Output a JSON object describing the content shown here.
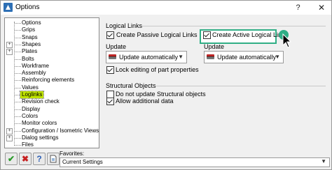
{
  "window": {
    "title": "Options",
    "help_glyph": "?",
    "close_glyph": "✕"
  },
  "tree": {
    "items": [
      {
        "label": "Options",
        "expander": ""
      },
      {
        "label": "Grips",
        "expander": ""
      },
      {
        "label": "Snaps",
        "expander": ""
      },
      {
        "label": "Shapes",
        "expander": "+"
      },
      {
        "label": "Plates",
        "expander": "+"
      },
      {
        "label": "Bolts",
        "expander": ""
      },
      {
        "label": "Workframe",
        "expander": ""
      },
      {
        "label": "Assembly",
        "expander": ""
      },
      {
        "label": "Reinforcing elements",
        "expander": ""
      },
      {
        "label": "Values",
        "expander": ""
      },
      {
        "label": "Loglinks",
        "expander": "",
        "selected": true
      },
      {
        "label": "Revision check",
        "expander": ""
      },
      {
        "label": "Display",
        "expander": ""
      },
      {
        "label": "Colors",
        "expander": ""
      },
      {
        "label": "Monitor colors",
        "expander": ""
      },
      {
        "label": "Configuration / Isometric Views",
        "expander": "+"
      },
      {
        "label": "Dialog settings",
        "expander": "+"
      },
      {
        "label": "Files",
        "expander": ""
      }
    ]
  },
  "logical_links": {
    "heading": "Logical Links",
    "passive": {
      "label": "Create Passive Logical Links",
      "checked": true
    },
    "active": {
      "label": "Create Active Logical Links",
      "checked": true
    },
    "update_left_label": "Update",
    "update_left_value": "Update automatically",
    "update_right_label": "Update",
    "update_right_value": "Update automatically",
    "lock": {
      "label": "Lock editing of part properties",
      "checked": true
    }
  },
  "structural": {
    "heading": "Structural Objects",
    "no_update": {
      "label": "Do not update Structural objects",
      "checked": false
    },
    "allow_data": {
      "label": "Allow additional data",
      "checked": true
    }
  },
  "bottom": {
    "ok_glyph": "✔",
    "cancel_glyph": "✖",
    "help_glyph": "?",
    "favorites_label": "Favorites:",
    "favorites_value": "Current Settings"
  },
  "colors": {
    "accent": "#2fae85",
    "selection": "#bfe300"
  }
}
